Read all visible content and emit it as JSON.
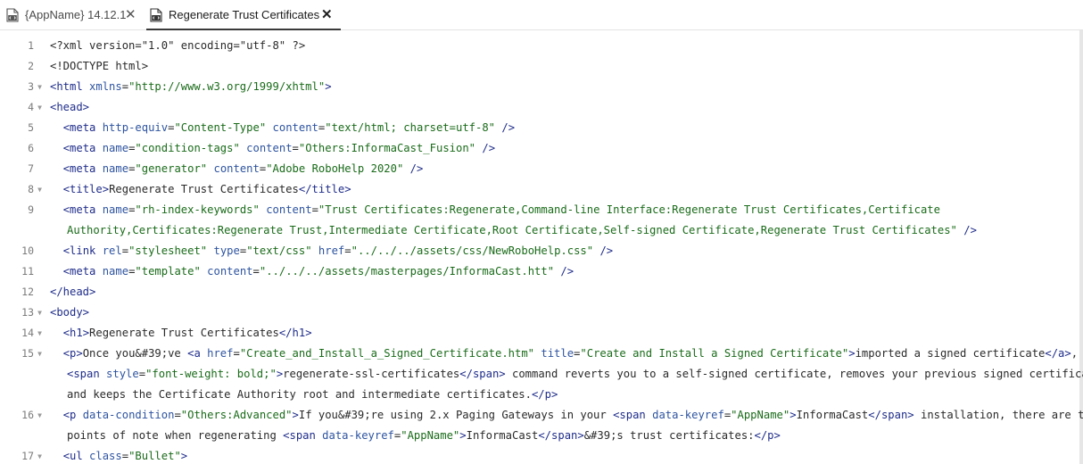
{
  "tabs": [
    {
      "label": "{AppName} 14.12.1",
      "icon": "html-file-icon",
      "close": "✕"
    },
    {
      "label": "Regenerate Trust Certificates",
      "icon": "html-file-icon",
      "close": "✕",
      "active": true
    }
  ],
  "gutter": [
    {
      "num": "1",
      "fold": ""
    },
    {
      "num": "2",
      "fold": ""
    },
    {
      "num": "3",
      "fold": "▼"
    },
    {
      "num": "4",
      "fold": "▼"
    },
    {
      "num": "5",
      "fold": ""
    },
    {
      "num": "6",
      "fold": ""
    },
    {
      "num": "7",
      "fold": ""
    },
    {
      "num": "8",
      "fold": "▼"
    },
    {
      "num": "9",
      "fold": ""
    },
    {
      "num": "10",
      "fold": ""
    },
    {
      "num": "11",
      "fold": ""
    },
    {
      "num": "12",
      "fold": ""
    },
    {
      "num": "13",
      "fold": "▼"
    },
    {
      "num": "14",
      "fold": "▼"
    },
    {
      "num": "15",
      "fold": "▼"
    },
    {
      "num": "16",
      "fold": "▼"
    },
    {
      "num": "17",
      "fold": "▼"
    }
  ],
  "code_rows": [
    [
      [
        "p",
        "<?xml version=\"1.0\" encoding=\"utf-8\" ?>"
      ]
    ],
    [
      [
        "p",
        "<!DOCTYPE html>"
      ]
    ],
    [
      [
        "t",
        "<html "
      ],
      [
        "a",
        "xmlns"
      ],
      [
        "p",
        "="
      ],
      [
        "v",
        "\"http://www.w3.org/1999/xhtml\""
      ],
      [
        "t",
        ">"
      ]
    ],
    [
      [
        "t",
        "<head>"
      ]
    ],
    [
      [
        "p",
        "  "
      ],
      [
        "t",
        "<meta "
      ],
      [
        "a",
        "http-equiv"
      ],
      [
        "p",
        "="
      ],
      [
        "v",
        "\"Content-Type\""
      ],
      [
        "p",
        " "
      ],
      [
        "a",
        "content"
      ],
      [
        "p",
        "="
      ],
      [
        "v",
        "\"text/html; charset=utf-8\""
      ],
      [
        "t",
        " />"
      ]
    ],
    [
      [
        "p",
        "  "
      ],
      [
        "t",
        "<meta "
      ],
      [
        "a",
        "name"
      ],
      [
        "p",
        "="
      ],
      [
        "v",
        "\"condition-tags\""
      ],
      [
        "p",
        " "
      ],
      [
        "a",
        "content"
      ],
      [
        "p",
        "="
      ],
      [
        "v",
        "\"Others:InformaCast_Fusion\""
      ],
      [
        "t",
        " />"
      ]
    ],
    [
      [
        "p",
        "  "
      ],
      [
        "t",
        "<meta "
      ],
      [
        "a",
        "name"
      ],
      [
        "p",
        "="
      ],
      [
        "v",
        "\"generator\""
      ],
      [
        "p",
        " "
      ],
      [
        "a",
        "content"
      ],
      [
        "p",
        "="
      ],
      [
        "v",
        "\"Adobe RoboHelp 2020\""
      ],
      [
        "t",
        " />"
      ]
    ],
    [
      [
        "p",
        "  "
      ],
      [
        "t",
        "<title>"
      ],
      [
        "p",
        "Regenerate Trust Certificates"
      ],
      [
        "t",
        "</title>"
      ]
    ],
    [
      [
        "p",
        "  "
      ],
      [
        "t",
        "<meta "
      ],
      [
        "a",
        "name"
      ],
      [
        "p",
        "="
      ],
      [
        "v",
        "\"rh-index-keywords\""
      ],
      [
        "p",
        " "
      ],
      [
        "a",
        "content"
      ],
      [
        "p",
        "="
      ],
      [
        "v",
        "\"Trust Certificates:Regenerate,Command-line Interface:Regenerate Trust Certificates,Certificate"
      ]
    ],
    [
      [
        "v",
        "Authority,Certificates:Regenerate Trust,Intermediate Certificate,Root Certificate,Self-signed Certificate,Regenerate Trust Certificates\""
      ],
      [
        "t",
        " />"
      ]
    ],
    [
      [
        "p",
        "  "
      ],
      [
        "t",
        "<link "
      ],
      [
        "a",
        "rel"
      ],
      [
        "p",
        "="
      ],
      [
        "v",
        "\"stylesheet\""
      ],
      [
        "p",
        " "
      ],
      [
        "a",
        "type"
      ],
      [
        "p",
        "="
      ],
      [
        "v",
        "\"text/css\""
      ],
      [
        "p",
        " "
      ],
      [
        "a",
        "href"
      ],
      [
        "p",
        "="
      ],
      [
        "v",
        "\"../../../assets/css/NewRoboHelp.css\""
      ],
      [
        "t",
        " />"
      ]
    ],
    [
      [
        "p",
        "  "
      ],
      [
        "t",
        "<meta "
      ],
      [
        "a",
        "name"
      ],
      [
        "p",
        "="
      ],
      [
        "v",
        "\"template\""
      ],
      [
        "p",
        " "
      ],
      [
        "a",
        "content"
      ],
      [
        "p",
        "="
      ],
      [
        "v",
        "\"../../../assets/masterpages/InformaCast.htt\""
      ],
      [
        "t",
        " />"
      ]
    ],
    [
      [
        "t",
        "</head>"
      ]
    ],
    [
      [
        "t",
        "<body>"
      ]
    ],
    [
      [
        "p",
        "  "
      ],
      [
        "t",
        "<h1>"
      ],
      [
        "p",
        "Regenerate Trust Certificates"
      ],
      [
        "t",
        "</h1>"
      ]
    ],
    [
      [
        "p",
        "  "
      ],
      [
        "t",
        "<p>"
      ],
      [
        "p",
        "Once you&#39;ve "
      ],
      [
        "t",
        "<a "
      ],
      [
        "a",
        "href"
      ],
      [
        "p",
        "="
      ],
      [
        "v",
        "\"Create_and_Install_a_Signed_Certificate.htm\""
      ],
      [
        "p",
        " "
      ],
      [
        "a",
        "title"
      ],
      [
        "p",
        "="
      ],
      [
        "v",
        "\"Create and Install a Signed Certificate\""
      ],
      [
        "t",
        ">"
      ],
      [
        "p",
        "imported a signed certificate"
      ],
      [
        "t",
        "</a>"
      ],
      [
        "p",
        ", the"
      ]
    ],
    [
      [
        "t",
        "<span "
      ],
      [
        "a",
        "style"
      ],
      [
        "p",
        "="
      ],
      [
        "v",
        "\"font-weight: bold;\""
      ],
      [
        "t",
        ">"
      ],
      [
        "p",
        "regenerate-ssl-certificates"
      ],
      [
        "t",
        "</span>"
      ],
      [
        "p",
        " command reverts you to a self-signed certificate, removes your previous signed certificate,"
      ]
    ],
    [
      [
        "p",
        "and keeps the Certificate Authority root and intermediate certificates."
      ],
      [
        "t",
        "</p>"
      ]
    ],
    [
      [
        "p",
        "  "
      ],
      [
        "t",
        "<p "
      ],
      [
        "a",
        "data-condition"
      ],
      [
        "p",
        "="
      ],
      [
        "v",
        "\"Others:Advanced\""
      ],
      [
        "t",
        ">"
      ],
      [
        "p",
        "If you&#39;re using 2.x Paging Gateways in your "
      ],
      [
        "t",
        "<span "
      ],
      [
        "a",
        "data-keyref"
      ],
      [
        "p",
        "="
      ],
      [
        "v",
        "\"AppName\""
      ],
      [
        "t",
        ">"
      ],
      [
        "p",
        "InformaCast"
      ],
      [
        "t",
        "</span>"
      ],
      [
        "p",
        " installation, there are two"
      ]
    ],
    [
      [
        "p",
        "points of note when regenerating "
      ],
      [
        "t",
        "<span "
      ],
      [
        "a",
        "data-keyref"
      ],
      [
        "p",
        "="
      ],
      [
        "v",
        "\"AppName\""
      ],
      [
        "t",
        ">"
      ],
      [
        "p",
        "InformaCast"
      ],
      [
        "t",
        "</span>"
      ],
      [
        "p",
        "&#39;s trust certificates:"
      ],
      [
        "t",
        "</p>"
      ]
    ],
    [
      [
        "p",
        "  "
      ],
      [
        "t",
        "<ul "
      ],
      [
        "a",
        "class"
      ],
      [
        "p",
        "="
      ],
      [
        "v",
        "\"Bullet\""
      ],
      [
        "t",
        ">"
      ]
    ]
  ]
}
